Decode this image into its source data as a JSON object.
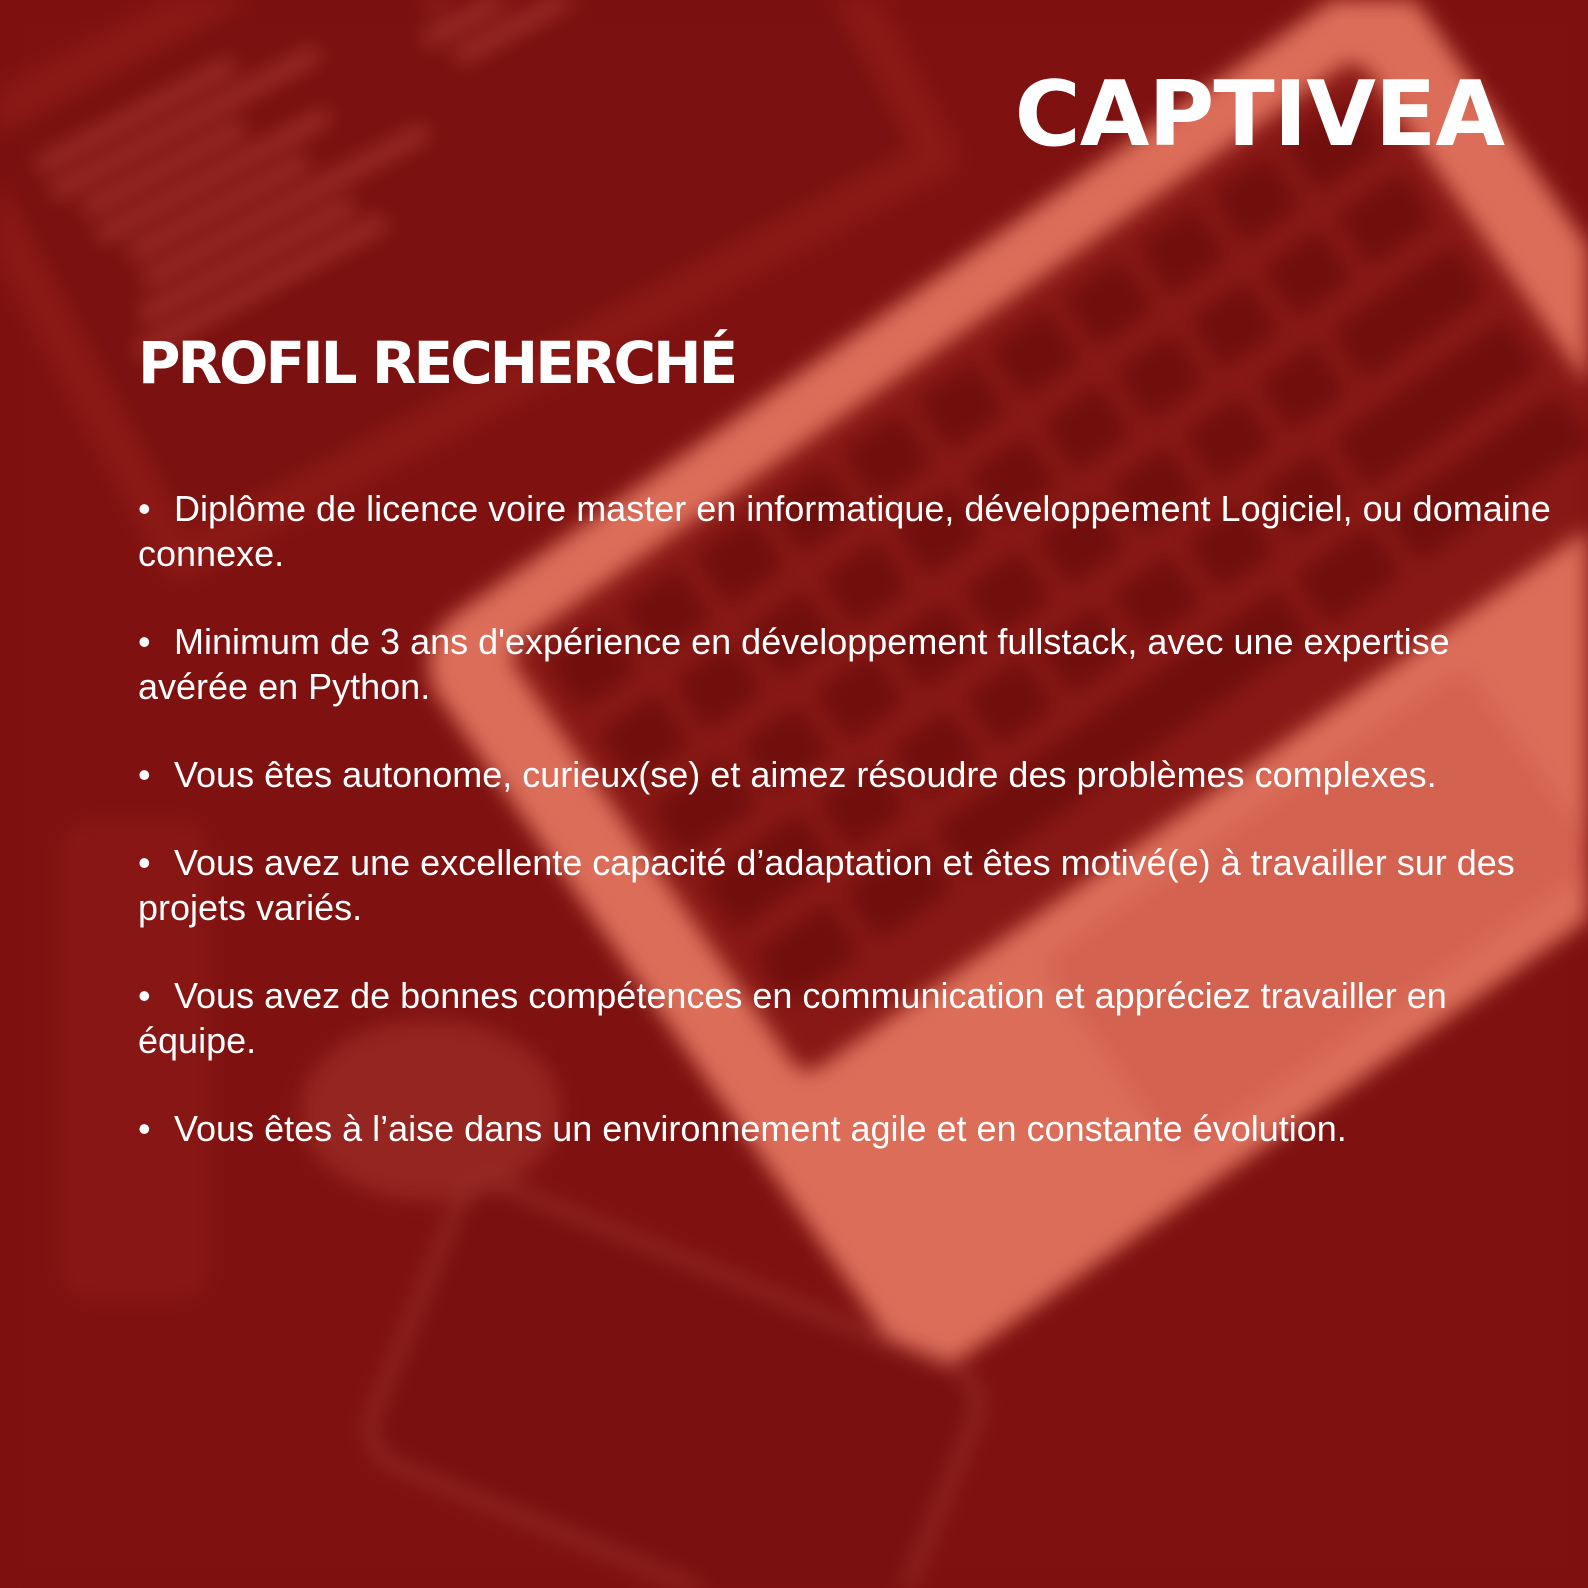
{
  "brand": {
    "logo_text": "CAPTIVEA"
  },
  "section": {
    "title": "PROFIL RECHERCHÉ"
  },
  "requirements": [
    "Diplôme de licence voire master en informatique, développement Logiciel, ou domaine connexe.",
    "Minimum de 3 ans d'expérience en développement fullstack, avec une expertise avérée en Python.",
    "Vous êtes autonome, curieux(se) et aimez résoudre des problèmes complexes.",
    "Vous avez une excellente capacité d’adaptation et êtes motivé(e) à travailler sur des projets variés.",
    "Vous avez de bonnes compétences en communication et appréciez travailler en équipe.",
    "Vous êtes à l’aise dans un environnement agile et en constante évolution."
  ],
  "colors": {
    "background": "#7f1211",
    "laptop": "#f0826a",
    "text": "#ffffff"
  }
}
